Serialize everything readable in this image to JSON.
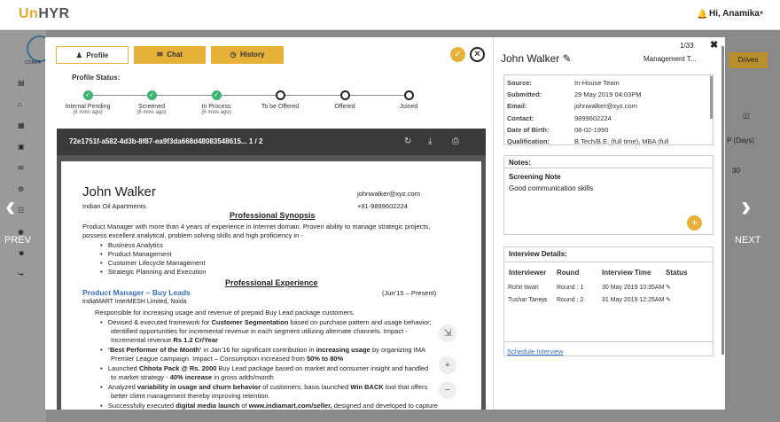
{
  "app": {
    "logo_a": "Un",
    "logo_b": "HYR",
    "greeting": "Hi, Anamika",
    "company_logo_text": "COMPA"
  },
  "bg": {
    "prev": "PREV",
    "next": "NEXT",
    "drives": "Drives",
    "col_days": "P (Days)",
    "val1": "30"
  },
  "tabs": {
    "profile": "Profile",
    "chat": "Chat",
    "history": "History"
  },
  "status": {
    "label": "Profile Status:",
    "stages": [
      {
        "name": "Internal Pending",
        "time": "(8 mins ago)",
        "done": true
      },
      {
        "name": "Screened",
        "time": "(8 mins ago)",
        "done": true
      },
      {
        "name": "In Process",
        "time": "(6 mins ago)",
        "done": true
      },
      {
        "name": "To be Offered",
        "time": "",
        "done": false
      },
      {
        "name": "Offered",
        "time": "",
        "done": false
      },
      {
        "name": "Joined",
        "time": "",
        "done": false
      }
    ]
  },
  "doc": {
    "name": "72e1751f-a582-4d3b-8f87-ea9f3da668d48083548615...",
    "pages": "1 / 2"
  },
  "resume": {
    "name": "John Walker",
    "company": "Indian Oil Apartments",
    "email": "johnwalker@xyz.com",
    "phone": "+91-9899602224",
    "h_synopsis": "Professional Synopsis",
    "synopsis1": "Product Manager with more than 4 years of experience in Internet domain. Proven ability to manage strategic projects,",
    "synopsis2": "possess excellent analytical, problem solving skills and high proficiency in -",
    "skills": [
      "Business Analytics",
      "Product Management",
      "Customer Lifecycle Management",
      "Strategic Planning and Execution"
    ],
    "h_experience": "Professional Experience",
    "role": "Product Manager – Buy Leads",
    "role_dates": "(Jun’15 – Present)",
    "employer": "IndiaMART InterMESH Limited, Noida",
    "resp": "Responsible for increasing usage and revenue of prepaid Buy Lead package customers.",
    "b1a": "Devised & executed framework for ",
    "b1b": "Customer Segmentation",
    "b1c": " based on purchase pattern and usage behavior;",
    "b1d": "identified opportunities for incremental revenue in each segment utilizing alternate channels. Impact -",
    "b1e": "Incremental revenue ",
    "b1f": "Rs 1.2 Cr/Year",
    "b2a": "‘Best Performer of the Month’",
    "b2b": " in Jan’16 for significant contribution in ",
    "b2c": "increasing usage",
    "b2d": " by organizing IMA",
    "b2e": "Premier League campaign. Impact – Consumption increased from ",
    "b2f": "50% to 80%",
    "b3a": "Launched ",
    "b3b": "Chhota Pack @ Rs. 2000",
    "b3c": " Buy Lead package based on market and consumer insight and handled",
    "b3d": "to market strategy - ",
    "b3e": "40% increase",
    "b3f": " in gross adds/month",
    "b4a": "Analyzed ",
    "b4b": "variability in usage and churn behavior",
    "b4c": " of customers, basis launched ",
    "b4d": "Win BACK",
    "b4e": " tool that offers",
    "b4f": "better client management thereby improving retention.",
    "b5a": "Successfully executed ",
    "b5b": "digital media launch",
    "b5c": " of ",
    "b5d": "www.indiamart.com/seller,",
    "b5e": " designed and developed to capture"
  },
  "candidate": {
    "counter": "1/33",
    "name": "John Walker",
    "role": "Management T...",
    "details": [
      {
        "k": "Source:",
        "v": "In-House Team"
      },
      {
        "k": "Submitted:",
        "v": "29 May 2019 04:03PM"
      },
      {
        "k": "Email:",
        "v": "johnwalker@xyz.com"
      },
      {
        "k": "Contact:",
        "v": "9899602224"
      },
      {
        "k": "Date of Birth:",
        "v": "08-02-1990"
      },
      {
        "k": "Qualification:",
        "v": "B.Tech/B.E. (full time), MBA (full"
      }
    ]
  },
  "notes": {
    "title": "Notes:",
    "note_title": "Screening Note",
    "note_body": "Good communication skills"
  },
  "interviews": {
    "title": "Interview Details:",
    "headers": [
      "Interviewer",
      "Round",
      "Interview Time",
      "Status"
    ],
    "rows": [
      {
        "interviewer": "Rohit tiwari",
        "round": "Round : 1",
        "time": "30 May 2019 10:35AM"
      },
      {
        "interviewer": "Tushar Taneja",
        "round": "Round : 2",
        "time": "31 May 2019 12:25AM"
      }
    ],
    "schedule": "Schedule Interview"
  },
  "colors": {
    "accent": "#e8b23a",
    "done": "#3cb371",
    "link": "#3a6fc4"
  },
  "icons": [
    "bell-icon",
    "user-icon",
    "chat-icon",
    "clock-icon",
    "check-icon",
    "close-icon",
    "edit-icon",
    "refresh-icon",
    "download-icon",
    "print-icon",
    "plus-icon",
    "minus-icon",
    "shrink-icon",
    "chevron-left-icon",
    "chevron-right-icon"
  ]
}
